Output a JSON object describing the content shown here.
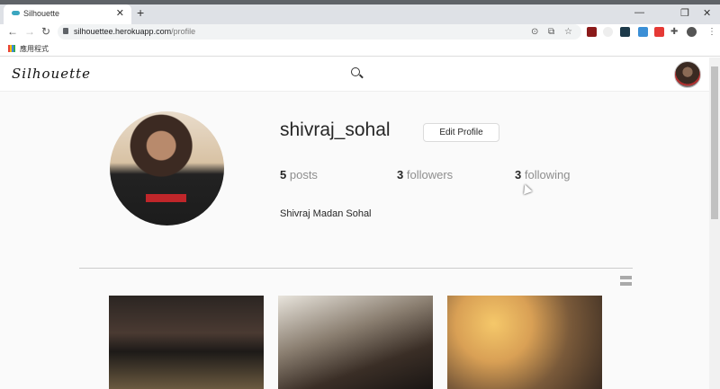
{
  "browser": {
    "tab_title": "Silhouette",
    "url_host": "silhouettee.herokuapp.com",
    "url_path": "/profile",
    "bookmarks_label": "應用程式"
  },
  "header": {
    "logo": "Silhouette"
  },
  "profile": {
    "username": "shivraj_sohal",
    "edit_label": "Edit Profile",
    "full_name": "Shivraj Madan Sohal",
    "stats": [
      {
        "count": "5",
        "label": "posts"
      },
      {
        "count": "3",
        "label": "followers"
      },
      {
        "count": "3",
        "label": "following"
      }
    ]
  }
}
